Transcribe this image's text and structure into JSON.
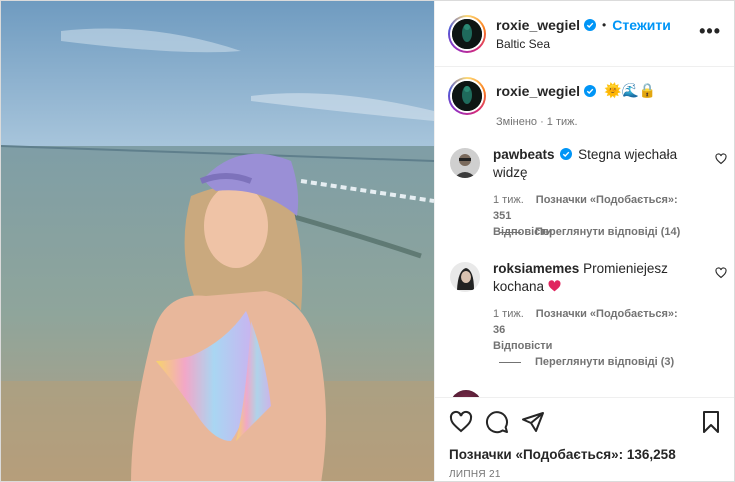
{
  "post": {
    "username": "roxie_wegiel",
    "follow_label": "Стежити",
    "location": "Baltic Sea",
    "more_label": "•••"
  },
  "caption": {
    "username": "roxie_wegiel",
    "emojis": "🌞🌊🔒",
    "edited": "Змінено · 1 тиж."
  },
  "comments": [
    {
      "username": "pawbeats",
      "verified": true,
      "text": "Stegna wjechała widzę",
      "time": "1 тиж.",
      "likes": "Позначки «Подобається»: 351",
      "reply_label": "Відповісти",
      "view_replies": "Переглянути відповіді (14)"
    },
    {
      "username": "roksiamemes",
      "verified": false,
      "text": "Promieniejesz kochana",
      "emoji": "❤️",
      "time": "1 тиж.",
      "likes": "Позначки «Подобається»: 36",
      "reply_label": "Відповісти",
      "view_replies": "Переглянути відповіді (3)"
    }
  ],
  "footer": {
    "likes_total": "Позначки «Подобається»: 136,258",
    "date": "ЛИПНЯ 21"
  },
  "icons": {
    "like": "heart-icon",
    "comment": "comment-icon",
    "share": "share-icon",
    "save": "bookmark-icon",
    "verified": "verified-badge-icon"
  },
  "colors": {
    "accent": "#0095f6",
    "verified": "#0095f6",
    "secondary_text": "#737373",
    "heart_red": "#e0245e"
  }
}
